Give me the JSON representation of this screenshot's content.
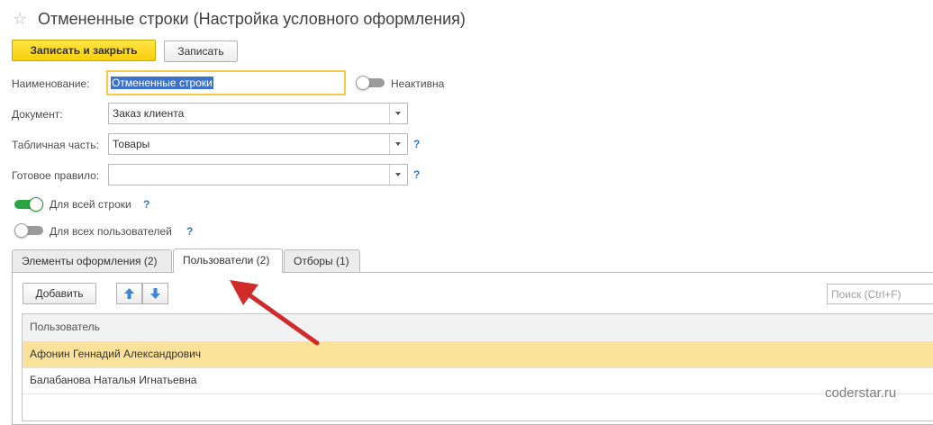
{
  "window": {
    "title": "Отмененные строки (Настройка условного оформления)"
  },
  "toolbar": {
    "save_close_label": "Записать и закрыть",
    "save_label": "Записать"
  },
  "form": {
    "name_label": "Наименование:",
    "name_value": "Отмененные строки",
    "inactive_label": "Неактивна",
    "inactive_on": false,
    "document_label": "Документ:",
    "document_value": "Заказ клиента",
    "tabular_label": "Табличная часть:",
    "tabular_value": "Товары",
    "rule_label": "Готовое правило:",
    "rule_value": "",
    "help_mark": "?",
    "whole_row_label": "Для всей строки",
    "whole_row_on": true,
    "all_users_label": "Для всех пользователей",
    "all_users_on": false
  },
  "tabs": [
    {
      "label": "Элементы оформления (2)",
      "active": false
    },
    {
      "label": "Пользователи (2)",
      "active": true
    },
    {
      "label": "Отборы (1)",
      "active": false
    }
  ],
  "users_panel": {
    "add_label": "Добавить",
    "search_placeholder": "Поиск (Ctrl+F)",
    "column_header": "Пользователь",
    "rows": [
      {
        "name": "Афонин Геннадий Александрович",
        "selected": true
      },
      {
        "name": "Балабанова Наталья Игнатьевна",
        "selected": false
      }
    ]
  },
  "annotation": {
    "arrow_color": "#d12a2a"
  },
  "watermark": "coderstar.ru",
  "colors": {
    "primary_button": "#f7d31a",
    "toggle_on": "#2aa542",
    "selection": "#3b73c8",
    "row_highlight": "#fbe29a",
    "help": "#3576be"
  }
}
